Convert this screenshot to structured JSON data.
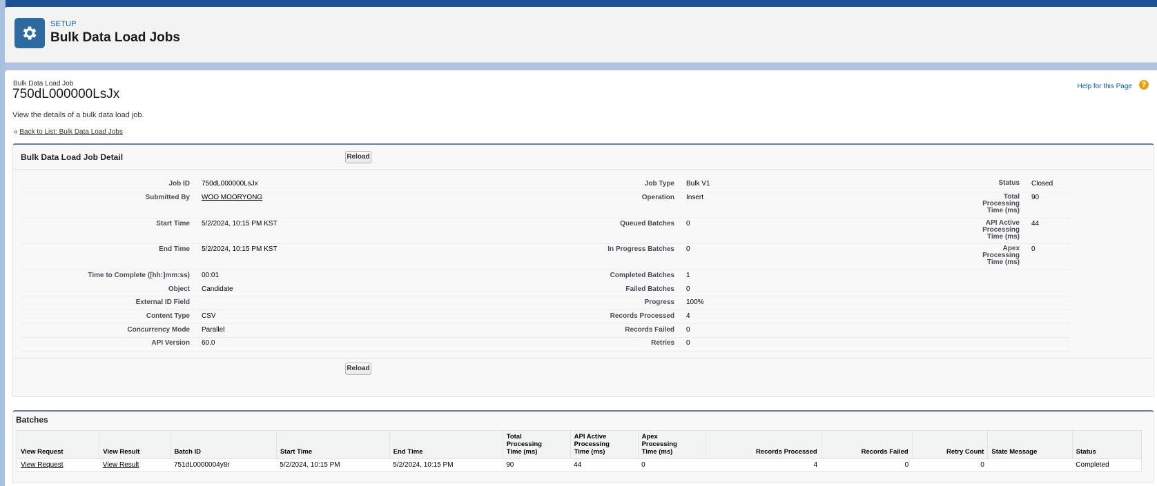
{
  "header": {
    "section": "SETUP",
    "title": "Bulk Data Load Jobs"
  },
  "page": {
    "record_type": "Bulk Data Load Job",
    "record_id": "750dL000000LsJx",
    "description": "View the details of a bulk data load job.",
    "back_prefix": "«",
    "back_link": "Back to List: Bulk Data Load Jobs",
    "help_link": "Help for this Page",
    "help_icon": "?"
  },
  "detail": {
    "title": "Bulk Data Load Job Detail",
    "reload_label": "Reload",
    "col1": [
      {
        "label": "Job ID",
        "value": "750dL000000LsJx"
      },
      {
        "label": "Submitted By",
        "value": "WOO MOORYONG"
      },
      {
        "label": "Start Time",
        "value": "5/2/2024, 10:15 PM KST"
      },
      {
        "label": "End Time",
        "value": "5/2/2024, 10:15 PM KST"
      },
      {
        "label": "Time to Complete ([hh:]mm:ss)",
        "value": "00:01"
      },
      {
        "label": "Object",
        "value": "Candidate"
      },
      {
        "label": "External ID Field",
        "value": ""
      },
      {
        "label": "Content Type",
        "value": "CSV"
      },
      {
        "label": "Concurrency Mode",
        "value": "Parallel"
      },
      {
        "label": "API Version",
        "value": "60.0"
      }
    ],
    "col2": [
      {
        "label": "Job Type",
        "value": "Bulk V1"
      },
      {
        "label": "Operation",
        "value": "Insert"
      },
      {
        "label": "Queued Batches",
        "value": "0"
      },
      {
        "label": "In Progress Batches",
        "value": "0"
      },
      {
        "label": "Completed Batches",
        "value": "1"
      },
      {
        "label": "Failed Batches",
        "value": "0"
      },
      {
        "label": "Progress",
        "value": "100%"
      },
      {
        "label": "Records Processed",
        "value": "4"
      },
      {
        "label": "Records Failed",
        "value": "0"
      },
      {
        "label": "Retries",
        "value": "0"
      }
    ],
    "col3": [
      {
        "label_lines": [
          "Status"
        ],
        "value": "Closed"
      },
      {
        "label_lines": [
          "Total",
          "Processing",
          "Time (ms)"
        ],
        "value": "90"
      },
      {
        "label_lines": [
          "API Active",
          "Processing",
          "Time (ms)"
        ],
        "value": "44"
      },
      {
        "label_lines": [
          "Apex",
          "Processing",
          "Time (ms)"
        ],
        "value": "0"
      }
    ]
  },
  "batches": {
    "title": "Batches",
    "columns": [
      [
        "View Request"
      ],
      [
        "View Result"
      ],
      [
        "Batch ID"
      ],
      [
        "Start Time"
      ],
      [
        "End Time"
      ],
      [
        "Total",
        "Processing",
        "Time (ms)"
      ],
      [
        "API Active",
        "Processing",
        "Time (ms)"
      ],
      [
        "Apex",
        "Processing",
        "Time (ms)"
      ],
      [
        "Records Processed"
      ],
      [
        "Records Failed"
      ],
      [
        "Retry Count"
      ],
      [
        "State Message"
      ],
      [
        "Status"
      ]
    ],
    "rows": [
      [
        "View Request",
        "View Result",
        "751dL0000004y8r",
        "5/2/2024, 10:15 PM",
        "5/2/2024, 10:15 PM",
        "90",
        "44",
        "0",
        "4",
        "0",
        "0",
        "",
        "Completed"
      ]
    ]
  }
}
